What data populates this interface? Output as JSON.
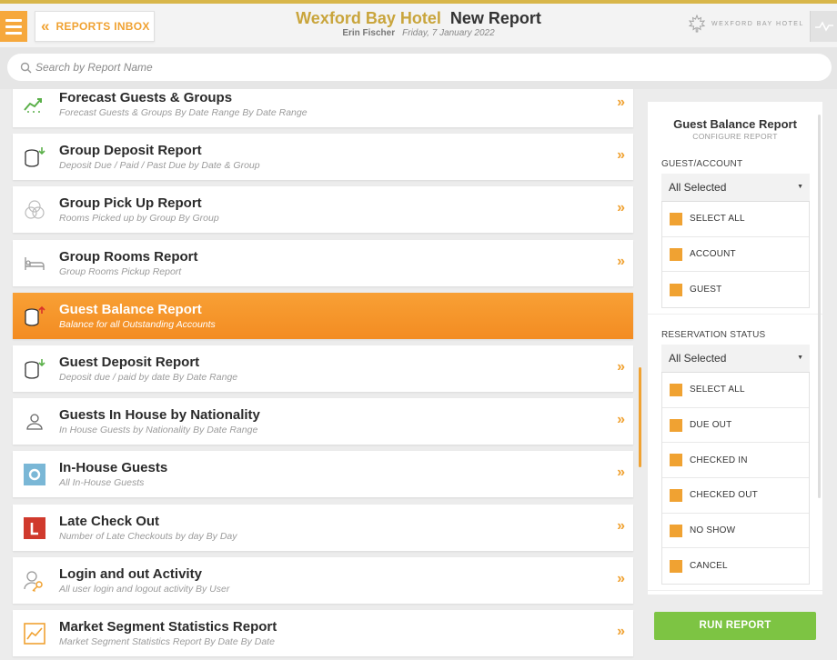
{
  "header": {
    "inbox_label": "REPORTS INBOX",
    "hotel_name": "Wexford Bay Hotel",
    "page_title": "New Report",
    "user_name": "Erin Fischer",
    "date": "Friday, 7 January 2022",
    "brand_text": "WEXFORD BAY HOTEL"
  },
  "search": {
    "placeholder": "Search by Report Name"
  },
  "reports": [
    {
      "title": "Forecast Guests & Groups",
      "desc": "Forecast Guests & Groups By Date Range By Date Range",
      "icon": "trend-icon"
    },
    {
      "title": "Group Deposit Report",
      "desc": "Deposit Due / Paid / Past Due by Date & Group",
      "icon": "coins-down-icon"
    },
    {
      "title": "Group Pick Up Report",
      "desc": "Rooms Picked up by Group By Group",
      "icon": "group-circles-icon"
    },
    {
      "title": "Group Rooms Report",
      "desc": "Group Rooms Pickup Report",
      "icon": "bed-icon"
    },
    {
      "title": "Guest Balance Report",
      "desc": "Balance for all Outstanding Accounts",
      "icon": "coins-up-icon",
      "active": true
    },
    {
      "title": "Guest Deposit Report",
      "desc": "Deposit due / paid by date By Date Range",
      "icon": "coins-down-icon"
    },
    {
      "title": "Guests In House by Nationality",
      "desc": "In House Guests by Nationality By Date Range",
      "icon": "person-icon"
    },
    {
      "title": "In-House Guests",
      "desc": "All In-House Guests",
      "icon": "in-house-icon"
    },
    {
      "title": "Late Check Out",
      "desc": "Number of Late Checkouts by day By Day",
      "icon": "late-checkout-icon"
    },
    {
      "title": "Login and out Activity",
      "desc": "All user login and logout activity By User",
      "icon": "user-key-icon"
    },
    {
      "title": "Market Segment Statistics Report",
      "desc": "Market Segment Statistics Report By Date By Date",
      "icon": "chart-icon"
    }
  ],
  "panel": {
    "title": "Guest Balance Report",
    "subtitle": "CONFIGURE REPORT",
    "guest_account": {
      "label": "GUEST/ACCOUNT",
      "selected": "All Selected",
      "options": [
        "SELECT ALL",
        "ACCOUNT",
        "GUEST"
      ]
    },
    "reservation_status": {
      "label": "RESERVATION STATUS",
      "selected": "All Selected",
      "options": [
        "SELECT ALL",
        "DUE OUT",
        "CHECKED IN",
        "CHECKED OUT",
        "NO SHOW",
        "CANCEL"
      ]
    },
    "run_label": "RUN REPORT"
  },
  "colors": {
    "accent": "#f0a232",
    "gold": "#c9a53c",
    "run_green": "#7dc443",
    "active_row": "#f5962a"
  }
}
